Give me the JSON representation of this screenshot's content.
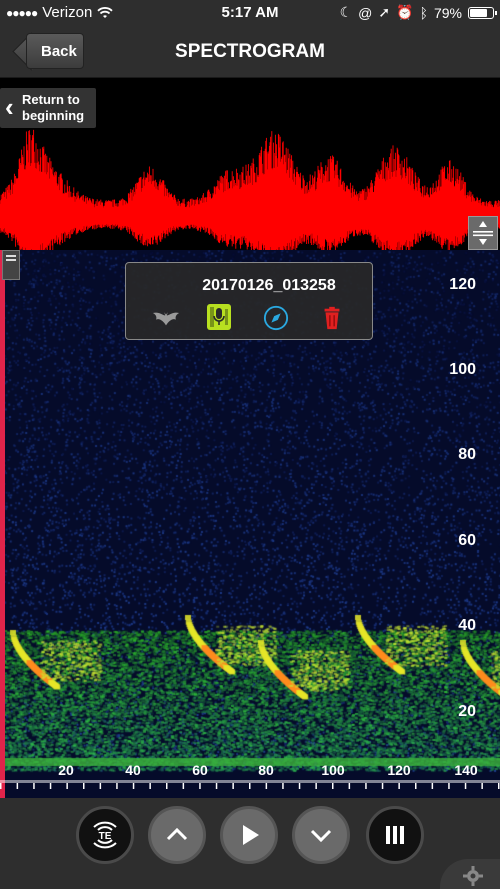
{
  "status": {
    "carrier": "Verizon",
    "time": "5:17 AM",
    "battery": "79%",
    "battery_level": 0.79
  },
  "nav": {
    "back_label": "Back",
    "title": "SPECTROGRAM"
  },
  "waveform": {
    "return_label_1": "Return to",
    "return_label_2": "beginning",
    "color": "#ff0000"
  },
  "popup": {
    "filename": "20170126_013258",
    "icons": [
      "bat-icon",
      "mic-device-icon",
      "compass-icon",
      "trash-icon"
    ]
  },
  "y_ticks": [
    "120",
    "100",
    "80",
    "60",
    "40",
    "20"
  ],
  "x_ticks": [
    "20",
    "40",
    "60",
    "80",
    "100",
    "120",
    "140"
  ],
  "toolbar": {
    "te_label": "TE",
    "buttons": [
      "te-button",
      "up-button",
      "play-button",
      "down-button",
      "menu-button"
    ]
  }
}
